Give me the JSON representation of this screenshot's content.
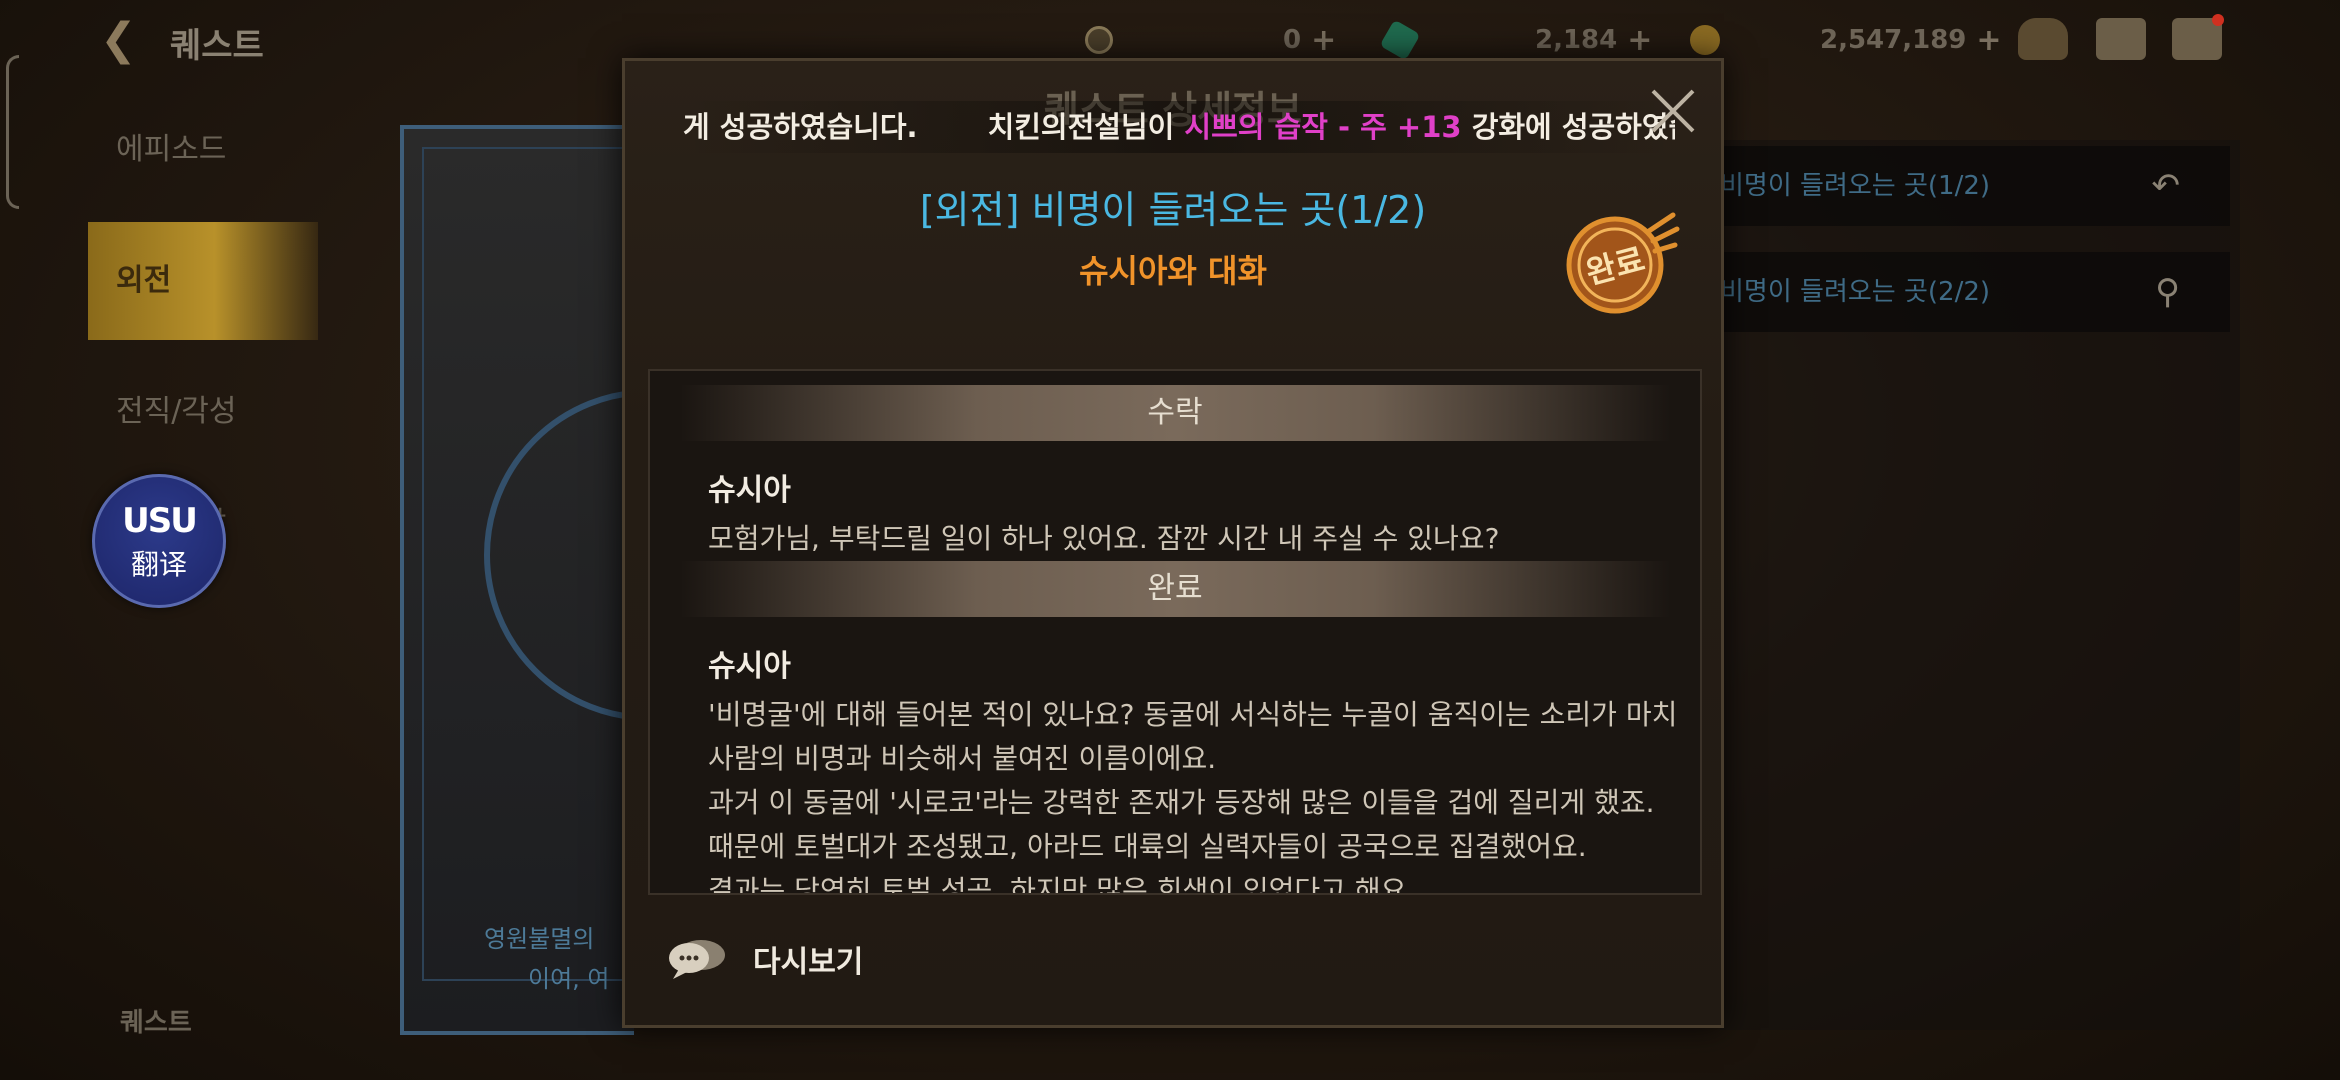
{
  "top_bar": {
    "title": "퀘스트",
    "currencies": [
      {
        "icon": "moon-coin-icon",
        "value": "0",
        "color": "#8a7a58"
      },
      {
        "icon": "green-gem-icon",
        "value": "2,184",
        "color": "#3aa87a"
      },
      {
        "icon": "gold-coin-icon",
        "value": "2,547,189",
        "color": "#c9962a"
      }
    ],
    "icons": [
      "bag-icon",
      "mail-icon",
      "chat-icon"
    ]
  },
  "left_menu": {
    "items": [
      {
        "label": "에피소드",
        "active": false
      },
      {
        "label": "외전",
        "active": true
      },
      {
        "label": "전직/각성",
        "active": false
      },
      {
        "label": "모험도감",
        "active": false
      }
    ],
    "bottom_label": "퀘스트"
  },
  "background_card": {
    "text_lines": [
      "영원불멸의",
      "이여, 여"
    ]
  },
  "right_panel": {
    "rows": [
      {
        "label": "비명이 들려오는 곳(1/2)",
        "icon": "return-icon"
      },
      {
        "label": "비명이 들려오는 곳(2/2)",
        "icon": "search-icon"
      }
    ]
  },
  "translate_button": {
    "logo": "USU",
    "label": "翻译"
  },
  "modal": {
    "title": "퀘스트 상세정보",
    "ticker": {
      "seg1": "게 성공하였습니다.",
      "seg2_pre": "치킨의전설님이 ",
      "seg2_item": "시쁘의 습작 - 주 +13",
      "seg2_post": " 강화에 성공하였습니다."
    },
    "quest_name": "[외전] 비명이 들려오는 곳(1/2)",
    "quest_sub": "슈시아와 대화",
    "stamp_label": "완료",
    "sections": [
      {
        "header": "수락",
        "speaker": "슈시아",
        "lines": [
          "모험가님, 부탁드릴 일이 하나 있어요. 잠깐 시간 내 주실 수 있나요?"
        ]
      },
      {
        "header": "완료",
        "speaker": "슈시아",
        "lines": [
          "'비명굴'에 대해 들어본 적이 있나요? 동굴에 서식하는 누골이 움직이는 소리가 마치",
          "사람의 비명과 비슷해서 붙여진 이름이에요.",
          "과거 이 동굴에 '시로코'라는 강력한 존재가 등장해 많은 이들을 겁에 질리게 했죠.",
          "때문에 토벌대가 조성됐고, 아라드 대륙의 실력자들이 공국으로 집결했어요.",
          "결과는 당연히 토벌 성공. 하지만 많은 희생이 있었다고 해요."
        ]
      }
    ],
    "replay_label": "다시보기"
  },
  "colors": {
    "quest_name": "#4ab8e2",
    "quest_sub": "#f0932a",
    "ticker_highlight": "#e040c8",
    "stamp": "#e08a2a"
  }
}
